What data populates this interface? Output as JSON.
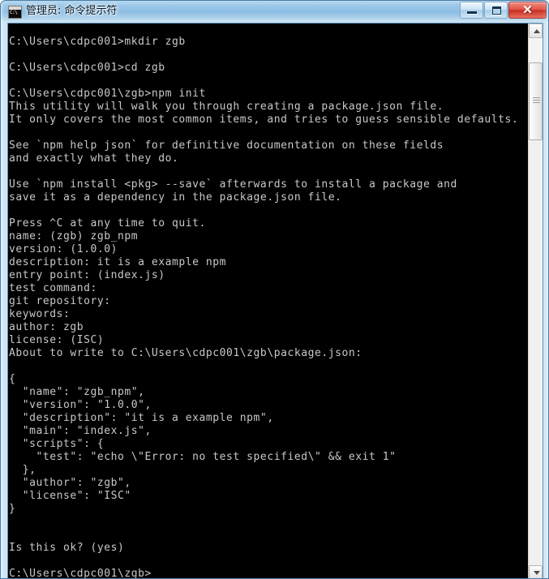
{
  "window": {
    "title": "管理员: 命令提示符",
    "icon_name": "cmd-icon",
    "icon_label": "C:\\",
    "controls": {
      "minimize": "—",
      "maximize": "□",
      "close": "✕"
    }
  },
  "console": {
    "background_color": "#000000",
    "text_color": "#c8c8c8",
    "lines": [
      "C:\\Users\\cdpc001>mkdir zgb",
      "",
      "C:\\Users\\cdpc001>cd zgb",
      "",
      "C:\\Users\\cdpc001\\zgb>npm init",
      "This utility will walk you through creating a package.json file.",
      "It only covers the most common items, and tries to guess sensible defaults.",
      "",
      "See `npm help json` for definitive documentation on these fields",
      "and exactly what they do.",
      "",
      "Use `npm install <pkg> --save` afterwards to install a package and",
      "save it as a dependency in the package.json file.",
      "",
      "Press ^C at any time to quit.",
      "name: (zgb) zgb_npm",
      "version: (1.0.0)",
      "description: it is a example npm",
      "entry point: (index.js)",
      "test command:",
      "git repository:",
      "keywords:",
      "author: zgb",
      "license: (ISC)",
      "About to write to C:\\Users\\cdpc001\\zgb\\package.json:",
      "",
      "{",
      "  \"name\": \"zgb_npm\",",
      "  \"version\": \"1.0.0\",",
      "  \"description\": \"it is a example npm\",",
      "  \"main\": \"index.js\",",
      "  \"scripts\": {",
      "    \"test\": \"echo \\\"Error: no test specified\\\" && exit 1\"",
      "  },",
      "  \"author\": \"zgb\",",
      "  \"license\": \"ISC\"",
      "}",
      "",
      "",
      "Is this ok? (yes)",
      "",
      "C:\\Users\\cdpc001\\zgb>"
    ]
  },
  "scrollbar": {
    "up_arrow": "scroll-up-arrow",
    "down_arrow": "scroll-down-arrow",
    "thumb": "scroll-thumb"
  }
}
